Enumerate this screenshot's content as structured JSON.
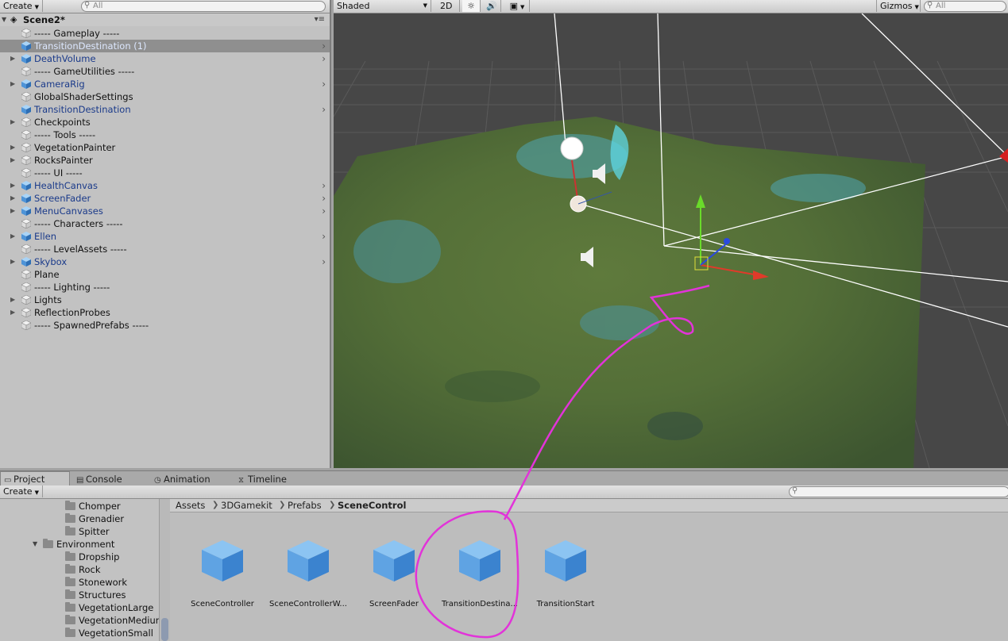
{
  "hierarchy": {
    "create_label": "Create",
    "search_placeholder": "All",
    "scene_title": "Scene2*",
    "items": [
      {
        "label": "----- Gameplay -----",
        "prefab": false,
        "expandable": false
      },
      {
        "label": "TransitionDestination (1)",
        "prefab": true,
        "expandable": false,
        "selected": true
      },
      {
        "label": "DeathVolume",
        "prefab": true,
        "expandable": true
      },
      {
        "label": "----- GameUtilities -----",
        "prefab": false,
        "expandable": false
      },
      {
        "label": "CameraRig",
        "prefab": true,
        "expandable": true
      },
      {
        "label": "GlobalShaderSettings",
        "prefab": false,
        "expandable": false
      },
      {
        "label": "TransitionDestination",
        "prefab": true,
        "expandable": false
      },
      {
        "label": "Checkpoints",
        "prefab": false,
        "expandable": true
      },
      {
        "label": "----- Tools -----",
        "prefab": false,
        "expandable": false
      },
      {
        "label": "VegetationPainter",
        "prefab": false,
        "expandable": true
      },
      {
        "label": "RocksPainter",
        "prefab": false,
        "expandable": true
      },
      {
        "label": "----- UI -----",
        "prefab": false,
        "expandable": false
      },
      {
        "label": "HealthCanvas",
        "prefab": true,
        "expandable": true
      },
      {
        "label": "ScreenFader",
        "prefab": true,
        "expandable": true
      },
      {
        "label": "MenuCanvases",
        "prefab": true,
        "expandable": true
      },
      {
        "label": "----- Characters -----",
        "prefab": false,
        "expandable": false
      },
      {
        "label": "Ellen",
        "prefab": true,
        "expandable": true
      },
      {
        "label": "----- LevelAssets -----",
        "prefab": false,
        "expandable": false
      },
      {
        "label": "Skybox",
        "prefab": true,
        "expandable": true
      },
      {
        "label": "Plane",
        "prefab": false,
        "expandable": false
      },
      {
        "label": "----- Lighting -----",
        "prefab": false,
        "expandable": false
      },
      {
        "label": "Lights",
        "prefab": false,
        "expandable": true
      },
      {
        "label": "ReflectionProbes",
        "prefab": false,
        "expandable": true
      },
      {
        "label": "----- SpawnedPrefabs -----",
        "prefab": false,
        "expandable": false
      }
    ]
  },
  "scene": {
    "shading_mode": "Shaded",
    "mode_2d": "2D",
    "gizmos_label": "Gizmos",
    "search_placeholder": "All"
  },
  "tabs": [
    {
      "label": "Project",
      "icon": "folder-icon",
      "active": true
    },
    {
      "label": "Console",
      "icon": "console-icon",
      "active": false
    },
    {
      "label": "Animation",
      "icon": "animation-icon",
      "active": false
    },
    {
      "label": "Timeline",
      "icon": "timeline-icon",
      "active": false
    }
  ],
  "project": {
    "create_label": "Create",
    "breadcrumb": [
      "Assets",
      "3DGamekit",
      "Prefabs",
      "SceneControl"
    ],
    "folders": [
      {
        "label": "Chomper",
        "indent": 1
      },
      {
        "label": "Grenadier",
        "indent": 1
      },
      {
        "label": "Spitter",
        "indent": 1
      },
      {
        "label": "Environment",
        "indent": 0,
        "expanded": true
      },
      {
        "label": "Dropship",
        "indent": 1
      },
      {
        "label": "Rock",
        "indent": 1
      },
      {
        "label": "Stonework",
        "indent": 1
      },
      {
        "label": "Structures",
        "indent": 1
      },
      {
        "label": "VegetationLarge",
        "indent": 1
      },
      {
        "label": "VegetationMedium",
        "indent": 1
      },
      {
        "label": "VegetationSmall",
        "indent": 1
      }
    ],
    "assets": [
      {
        "label": "SceneController"
      },
      {
        "label": "SceneControllerW..."
      },
      {
        "label": "ScreenFader"
      },
      {
        "label": "TransitionDestina..."
      },
      {
        "label": "TransitionStart"
      }
    ]
  },
  "colors": {
    "annotation": "#e233d9",
    "prefab_text": "#1a3a8a",
    "cube_light": "#8cc4f2",
    "cube_dark": "#3b83cf"
  }
}
